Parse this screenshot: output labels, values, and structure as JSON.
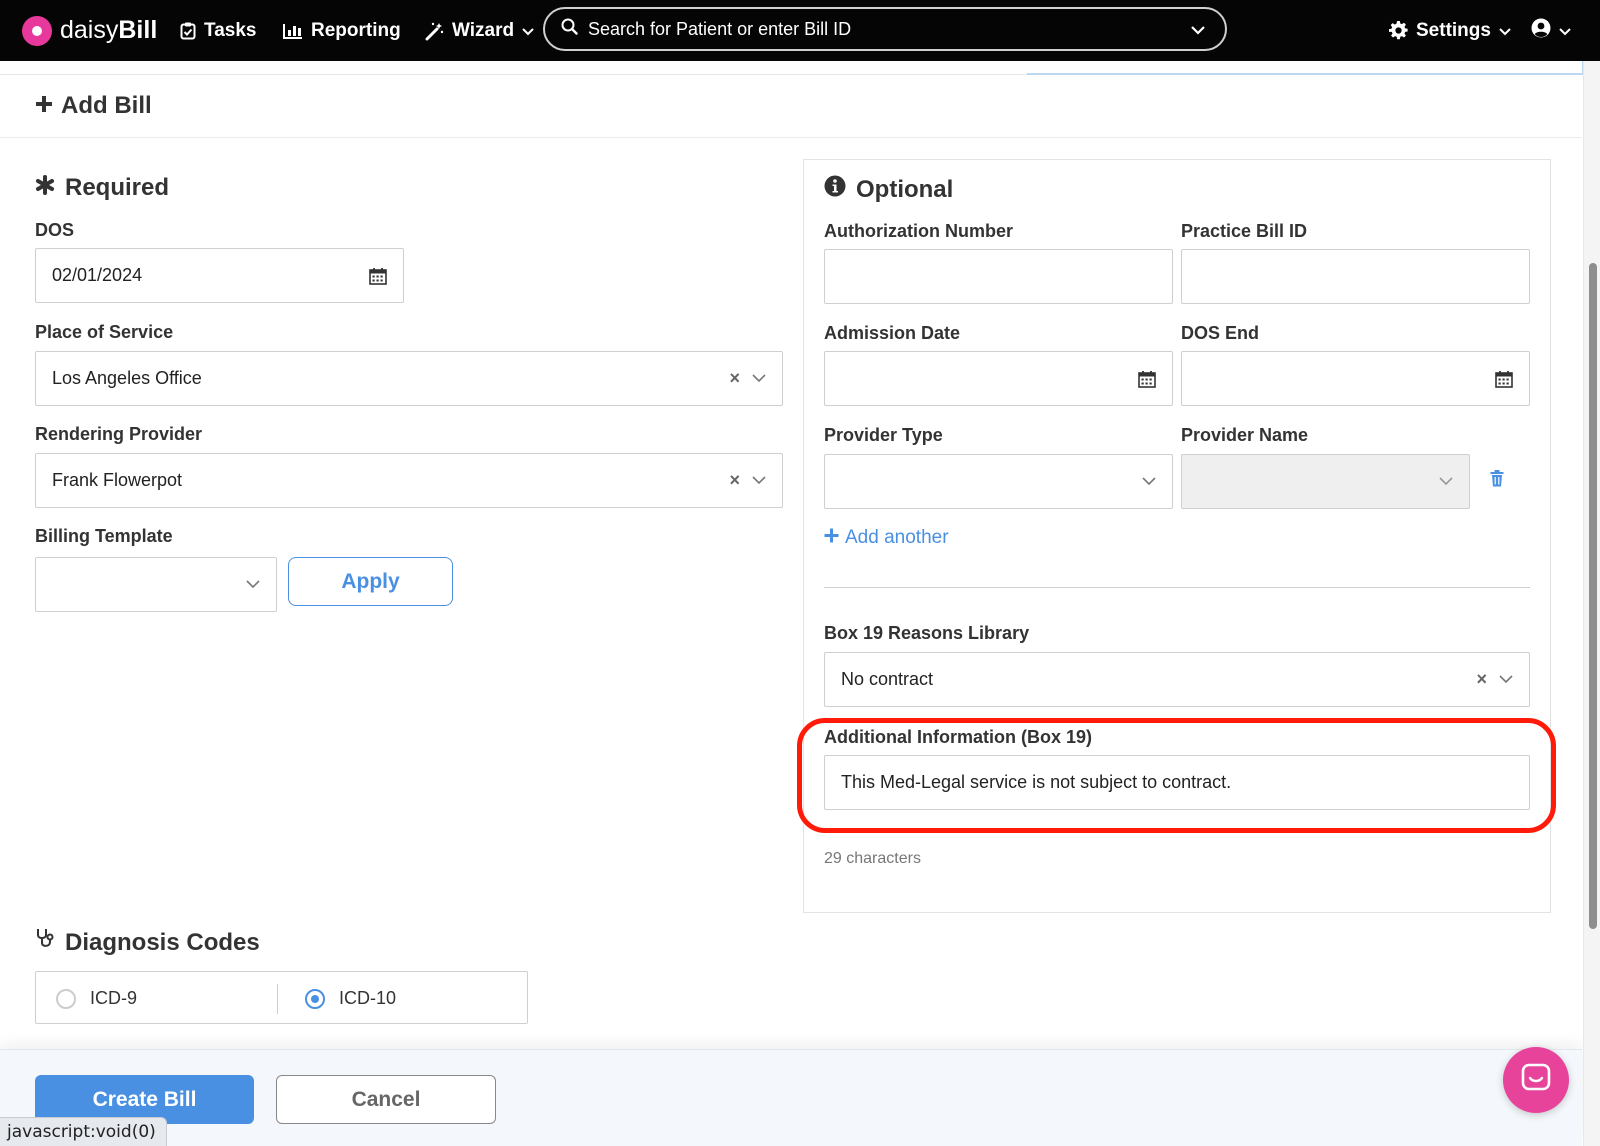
{
  "nav": {
    "brand_part1": "daisy",
    "brand_part2": "Bill",
    "tasks": "Tasks",
    "reporting": "Reporting",
    "wizard": "Wizard",
    "search_placeholder": "Search for Patient or enter Bill ID",
    "settings": "Settings"
  },
  "page": {
    "title": "Add Bill"
  },
  "required": {
    "heading": "Required",
    "dos_label": "DOS",
    "dos_value": "02/01/2024",
    "place_label": "Place of Service",
    "place_value": "Los Angeles Office",
    "provider_label": "Rendering Provider",
    "provider_value": "Frank Flowerpot",
    "template_label": "Billing Template",
    "template_value": "",
    "apply_label": "Apply"
  },
  "optional": {
    "heading": "Optional",
    "auth_label": "Authorization Number",
    "auth_value": "",
    "practice_id_label": "Practice Bill ID",
    "practice_id_value": "",
    "admission_label": "Admission Date",
    "admission_value": "",
    "dos_end_label": "DOS End",
    "dos_end_value": "",
    "provider_type_label": "Provider Type",
    "provider_type_value": "",
    "provider_name_label": "Provider Name",
    "provider_name_value": "",
    "add_another_label": "Add another",
    "box19_library_label": "Box 19 Reasons Library",
    "box19_library_value": "No contract",
    "additional_info_label": "Additional Information (Box 19)",
    "additional_info_value": "This Med-Legal service is not subject to contract.",
    "char_count": "29 characters"
  },
  "diagnosis": {
    "heading": "Diagnosis Codes",
    "options": [
      {
        "label": "ICD-9",
        "selected": false
      },
      {
        "label": "ICD-10",
        "selected": true
      }
    ]
  },
  "footer": {
    "create_label": "Create Bill",
    "cancel_label": "Cancel",
    "status_url": "javascript:void(0)"
  },
  "colors": {
    "accent": "#4a90e2",
    "brand_pink": "#e8439a",
    "highlight_red": "#ff1a0a",
    "navbar_bg": "#050505"
  }
}
